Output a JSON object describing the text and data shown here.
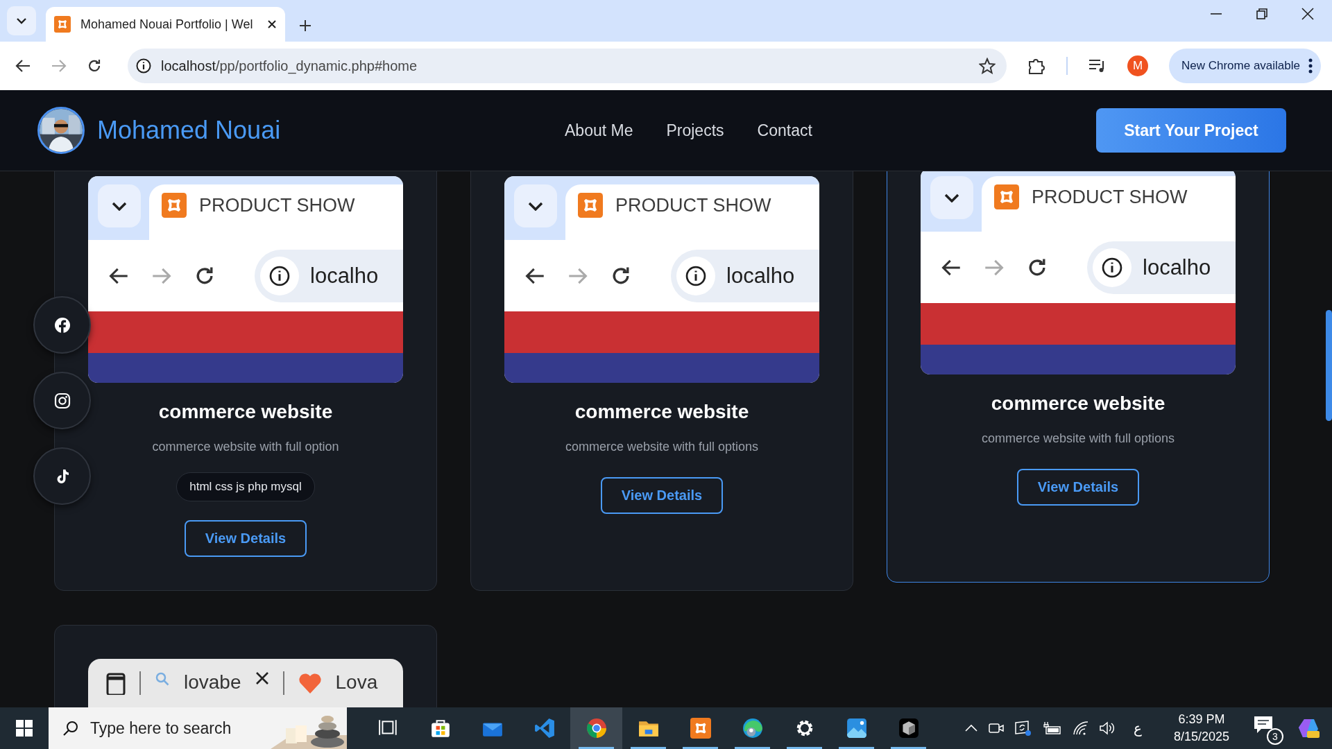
{
  "browser": {
    "tab": {
      "title": "Mohamed Nouai Portfolio | Wel",
      "selected": true
    },
    "address": {
      "host": "localhost",
      "path": "/pp/portfolio_dynamic.php#home"
    },
    "profile_initial": "M",
    "update_button": "New Chrome available"
  },
  "header": {
    "name": "Mohamed Nouai",
    "nav": [
      {
        "label": "About Me"
      },
      {
        "label": "Projects"
      },
      {
        "label": "Contact"
      }
    ],
    "cta": "Start Your Project"
  },
  "social": [
    {
      "kind": "facebook"
    },
    {
      "kind": "instagram"
    },
    {
      "kind": "tiktok"
    }
  ],
  "projects": [
    {
      "shot": {
        "tab_title": "PRODUCT SHOW",
        "address": "localho"
      },
      "title": "commerce website",
      "description": "commerce website with full option",
      "tags": "html css js php mysql",
      "button": "View Details",
      "hovered": false
    },
    {
      "shot": {
        "tab_title": "PRODUCT SHOW",
        "address": "localho"
      },
      "title": "commerce website",
      "description": "commerce website with full options",
      "button": "View Details",
      "hovered": false
    },
    {
      "shot": {
        "tab_title": "PRODUCT SHOW",
        "address": "localho"
      },
      "title": "commerce website",
      "description": "commerce website with full options",
      "button": "View Details",
      "hovered": true
    }
  ],
  "partial_project": {
    "shot": {
      "search": "lovabe",
      "tab_title": "Lova"
    }
  },
  "taskbar": {
    "search_placeholder": "Type here to search",
    "apps": [
      {
        "kind": "taskview",
        "running": false,
        "selected": false
      },
      {
        "kind": "store",
        "running": false,
        "selected": false
      },
      {
        "kind": "mail",
        "running": false,
        "selected": false
      },
      {
        "kind": "vscode",
        "running": false,
        "selected": false
      },
      {
        "kind": "chrome",
        "running": true,
        "selected": true
      },
      {
        "kind": "files",
        "running": true,
        "selected": false
      },
      {
        "kind": "xampp",
        "running": true,
        "selected": false
      },
      {
        "kind": "edge",
        "running": true,
        "selected": false
      },
      {
        "kind": "settings",
        "running": true,
        "selected": false
      },
      {
        "kind": "photos",
        "running": true,
        "selected": false
      },
      {
        "kind": "box",
        "running": true,
        "selected": false
      }
    ],
    "language": "ع",
    "time": "6:39 PM",
    "date": "8/15/2025",
    "notifications": "3"
  }
}
